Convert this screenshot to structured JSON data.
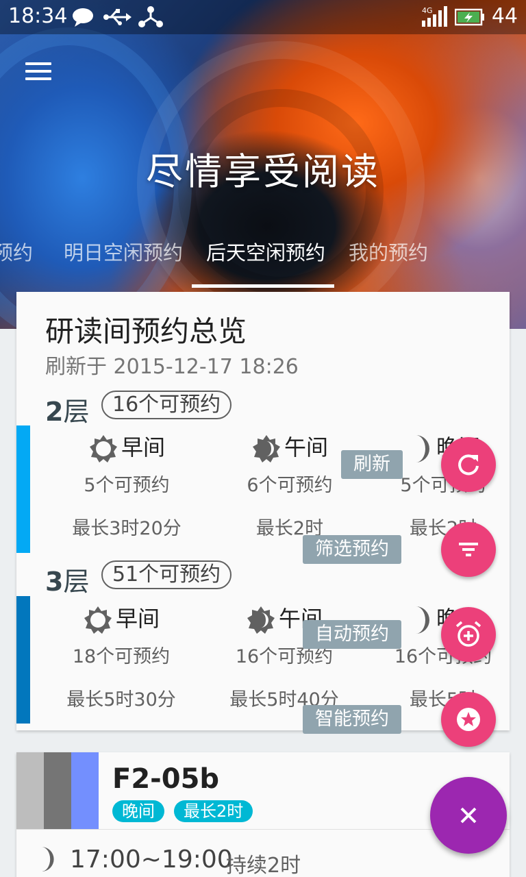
{
  "status_bar": {
    "time": "18:34",
    "network": "4G",
    "battery": "44"
  },
  "header": {
    "title": "尽情享受阅读",
    "tabs": [
      {
        "label": "预约",
        "active": false
      },
      {
        "label": "明日空闲预约",
        "active": false
      },
      {
        "label": "后天空闲预约",
        "active": true
      },
      {
        "label": "我的预约",
        "active": false
      }
    ]
  },
  "overview": {
    "title": "研读间预约总览",
    "refreshed": "刷新于 2015-12-17 18:26",
    "floors": [
      {
        "name": "2",
        "unit": "层",
        "badge": "16个可预约",
        "bar_color": "#03a9f4",
        "slots": [
          {
            "name": "早间",
            "icon": "sun-icon",
            "available": "5个可预约",
            "max": "最长3时20分"
          },
          {
            "name": "午间",
            "icon": "half-sun-icon",
            "available": "6个可预约",
            "max": "最长2时"
          },
          {
            "name": "晚间",
            "icon": "moon-icon",
            "available": "5个可预约",
            "max": "最长2时"
          }
        ]
      },
      {
        "name": "3",
        "unit": "层",
        "badge": "51个可预约",
        "bar_color": "#0277bd",
        "slots": [
          {
            "name": "早间",
            "icon": "sun-icon",
            "available": "18个可预约",
            "max": "最长5时30分"
          },
          {
            "name": "午间",
            "icon": "half-sun-icon",
            "available": "16个可预约",
            "max": "最长5时40分"
          },
          {
            "name": "晚间",
            "icon": "moon-icon",
            "available": "16个可预约",
            "max": "最长5时"
          }
        ]
      }
    ]
  },
  "room": {
    "name": "F2-05b",
    "colors": [
      "#bdbdbd",
      "#757575",
      "#738ffe"
    ],
    "chips": [
      "晚间",
      "最长2时"
    ],
    "time": "17:00~19:00",
    "duration": "持续2时"
  },
  "fab_menu": {
    "items": [
      {
        "label": "刷新",
        "icon": "refresh-icon"
      },
      {
        "label": "筛选预约",
        "icon": "filter-icon"
      },
      {
        "label": "自动预约",
        "icon": "alarm-add-icon"
      },
      {
        "label": "智能预约",
        "icon": "star-icon"
      }
    ],
    "main_icon": "close-icon",
    "mini_color": "#ec407a",
    "main_color": "#9c27b0"
  }
}
